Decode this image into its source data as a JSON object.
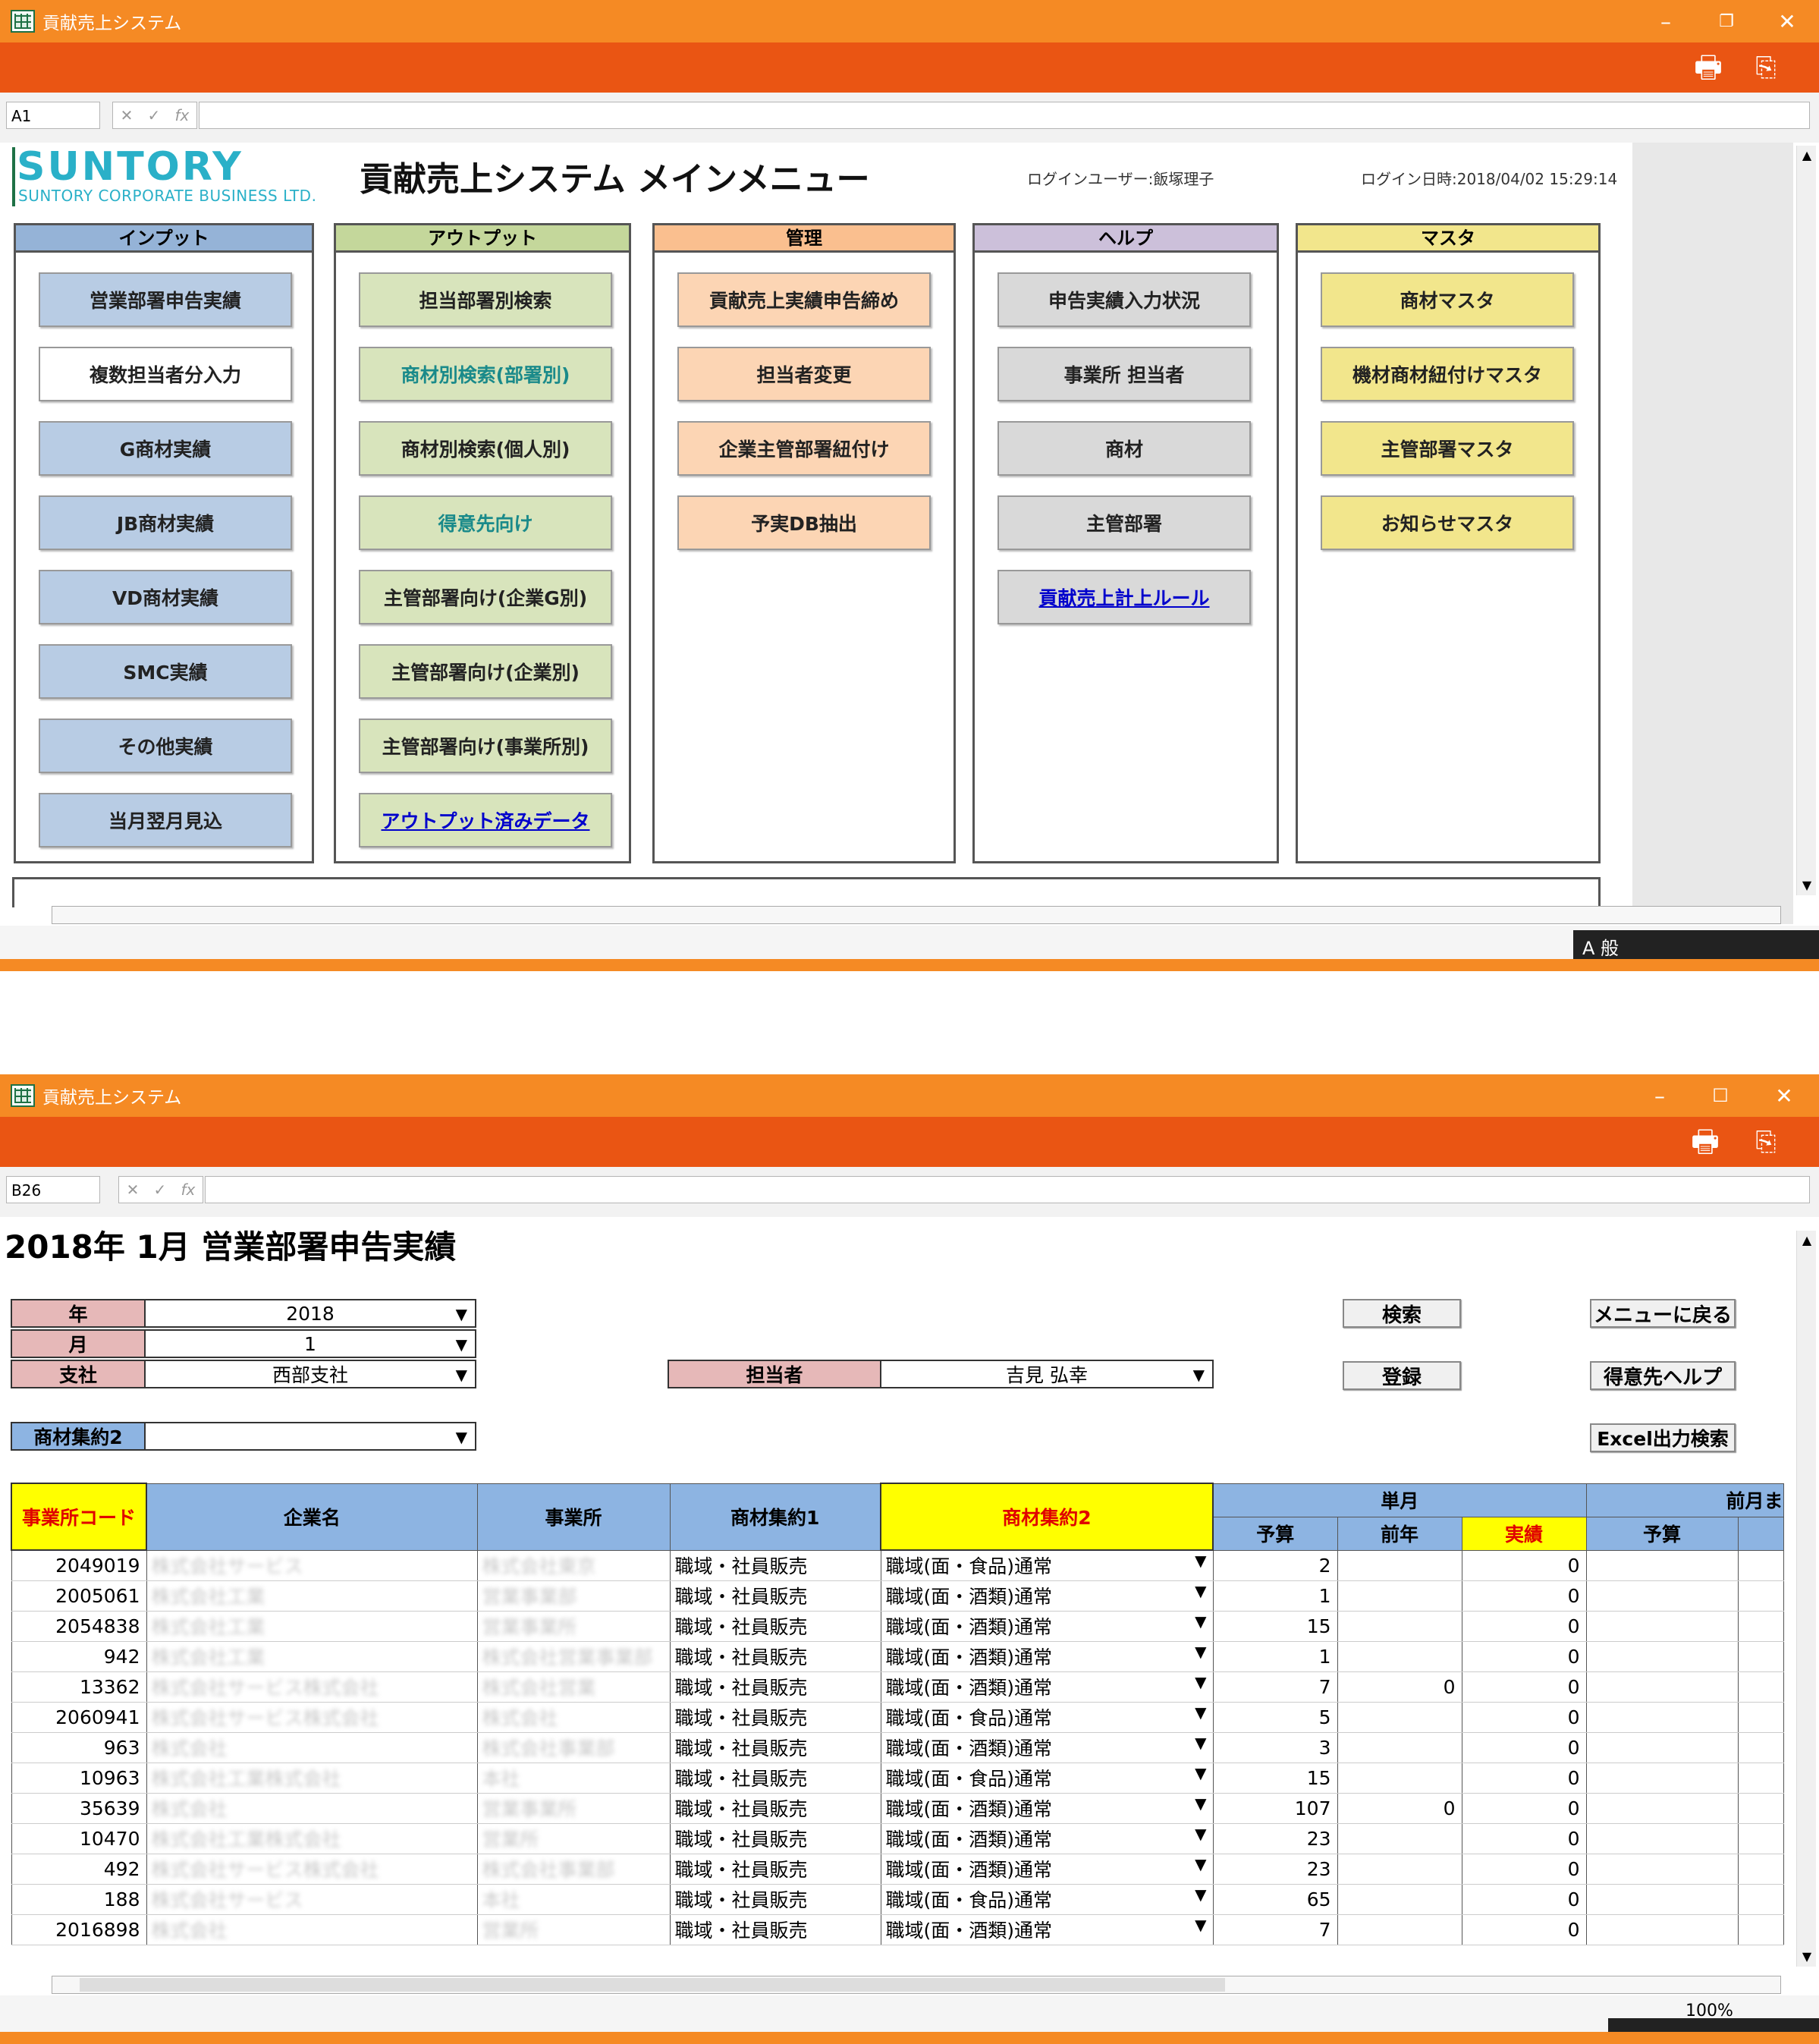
{
  "menu_window": {
    "title": "貢献売上システム",
    "cell_ref": "A1",
    "logo_main": "SUNTORY",
    "logo_sub": "SUNTORY CORPORATE BUSINESS LTD.",
    "page_title": "貢献売上システム メインメニュー",
    "login_user": "ログインユーザー:飯塚理子",
    "login_time": "ログイン日時:2018/04/02 15:29:14",
    "panels": [
      {
        "header": "インプット",
        "color": "#b8cce4",
        "hcolor": "#95b3d7",
        "buttons": [
          "営業部署申告実績",
          "複数担当者分入力",
          "G商材実績",
          "JB商材実績",
          "VD商材実績",
          "SMC実績",
          "その他実績",
          "当月翌月見込"
        ]
      },
      {
        "header": "アウトプット",
        "color": "#d8e4bc",
        "hcolor": "#c4d79b",
        "buttons": [
          "担当部署別検索",
          "商材別検索(部署別)",
          "商材別検索(個人別)",
          "得意先向け",
          "主管部署向け(企業G別)",
          "主管部署向け(企業別)",
          "主管部署向け(事業所別)",
          "アウトプット済みデータ"
        ]
      },
      {
        "header": "管理",
        "color": "#fcd5b4",
        "hcolor": "#fabf8f",
        "buttons": [
          "貢献売上実績申告締め",
          "担当者変更",
          "企業主管部署紐付け",
          "予実DB抽出"
        ]
      },
      {
        "header": "ヘルプ",
        "color": "#d9d9d9",
        "hcolor": "#ccc0da",
        "buttons": [
          "申告実績入力状況",
          "事業所 担当者",
          "商材",
          "主管部署",
          "貢献売上計上ルール"
        ]
      },
      {
        "header": "マスタ",
        "color": "#f2e68c",
        "hcolor": "#f2e68c",
        "buttons": [
          "商材マスタ",
          "機材商材紐付けマスタ",
          "主管部署マスタ",
          "お知らせマスタ"
        ]
      }
    ]
  },
  "entry_window": {
    "title": "貢献売上システム",
    "cell_ref": "B26",
    "zoom": "100%",
    "page_title": "2018年 1月 営業部署申告実績",
    "filters": {
      "year_label": "年",
      "year_value": "2018",
      "month_label": "月",
      "month_value": "1",
      "branch_label": "支社",
      "branch_value": "西部支社",
      "person_label": "担当者",
      "person_value": "吉見 弘幸",
      "cat2_label": "商材集約2",
      "cat2_value": ""
    },
    "buttons": {
      "search": "検索",
      "register": "登録",
      "back": "メニューに戻る",
      "help": "得意先ヘルプ",
      "excel": "Excel出力検索"
    },
    "columns": {
      "office_code": "事業所コード",
      "company": "企業名",
      "office": "事業所",
      "cat1": "商材集約1",
      "cat2": "商材集約2",
      "single_month": "単月",
      "prev_month": "前月ま",
      "budget": "予算",
      "prev_year": "前年",
      "actual": "実績",
      "budget2": "予算"
    },
    "rows": [
      {
        "code": "2049019",
        "company": "株式会社サービス",
        "office": "株式会社東京",
        "cat1": "職域・社員販売",
        "cat2": "職域(面・食品)通常",
        "budget": "2",
        "prev": "",
        "actual": "0"
      },
      {
        "code": "2005061",
        "company": "株式会社工業",
        "office": "営業事業部",
        "cat1": "職域・社員販売",
        "cat2": "職域(面・酒類)通常",
        "budget": "1",
        "prev": "",
        "actual": "0"
      },
      {
        "code": "2054838",
        "company": "株式会社工業",
        "office": "営業事業所",
        "cat1": "職域・社員販売",
        "cat2": "職域(面・酒類)通常",
        "budget": "15",
        "prev": "",
        "actual": "0"
      },
      {
        "code": "942",
        "company": "株式会社工業",
        "office": "株式会社営業事業部",
        "cat1": "職域・社員販売",
        "cat2": "職域(面・酒類)通常",
        "budget": "1",
        "prev": "",
        "actual": "0"
      },
      {
        "code": "13362",
        "company": "株式会社サービス株式会社",
        "office": "株式会社営業",
        "cat1": "職域・社員販売",
        "cat2": "職域(面・酒類)通常",
        "budget": "7",
        "prev": "0",
        "actual": "0"
      },
      {
        "code": "2060941",
        "company": "株式会社サービス株式会社",
        "office": "株式会社",
        "cat1": "職域・社員販売",
        "cat2": "職域(面・食品)通常",
        "budget": "5",
        "prev": "",
        "actual": "0"
      },
      {
        "code": "963",
        "company": "株式会社",
        "office": "株式会社事業部",
        "cat1": "職域・社員販売",
        "cat2": "職域(面・酒類)通常",
        "budget": "3",
        "prev": "",
        "actual": "0"
      },
      {
        "code": "10963",
        "company": "株式会社工業株式会社",
        "office": "本社",
        "cat1": "職域・社員販売",
        "cat2": "職域(面・食品)通常",
        "budget": "15",
        "prev": "",
        "actual": "0"
      },
      {
        "code": "35639",
        "company": "株式会社",
        "office": "営業事業所",
        "cat1": "職域・社員販売",
        "cat2": "職域(面・酒類)通常",
        "budget": "107",
        "prev": "0",
        "actual": "0"
      },
      {
        "code": "10470",
        "company": "株式会社工業株式会社",
        "office": "営業所",
        "cat1": "職域・社員販売",
        "cat2": "職域(面・酒類)通常",
        "budget": "23",
        "prev": "",
        "actual": "0"
      },
      {
        "code": "492",
        "company": "株式会社サービス株式会社",
        "office": "株式会社事業部",
        "cat1": "職域・社員販売",
        "cat2": "職域(面・酒類)通常",
        "budget": "23",
        "prev": "",
        "actual": "0"
      },
      {
        "code": "188",
        "company": "株式会社サービス",
        "office": "本社",
        "cat1": "職域・社員販売",
        "cat2": "職域(面・食品)通常",
        "budget": "65",
        "prev": "",
        "actual": "0"
      },
      {
        "code": "2016898",
        "company": "株式会社",
        "office": "営業所",
        "cat1": "職域・社員販売",
        "cat2": "職域(面・酒類)通常",
        "budget": "7",
        "prev": "",
        "actual": "0"
      }
    ]
  }
}
